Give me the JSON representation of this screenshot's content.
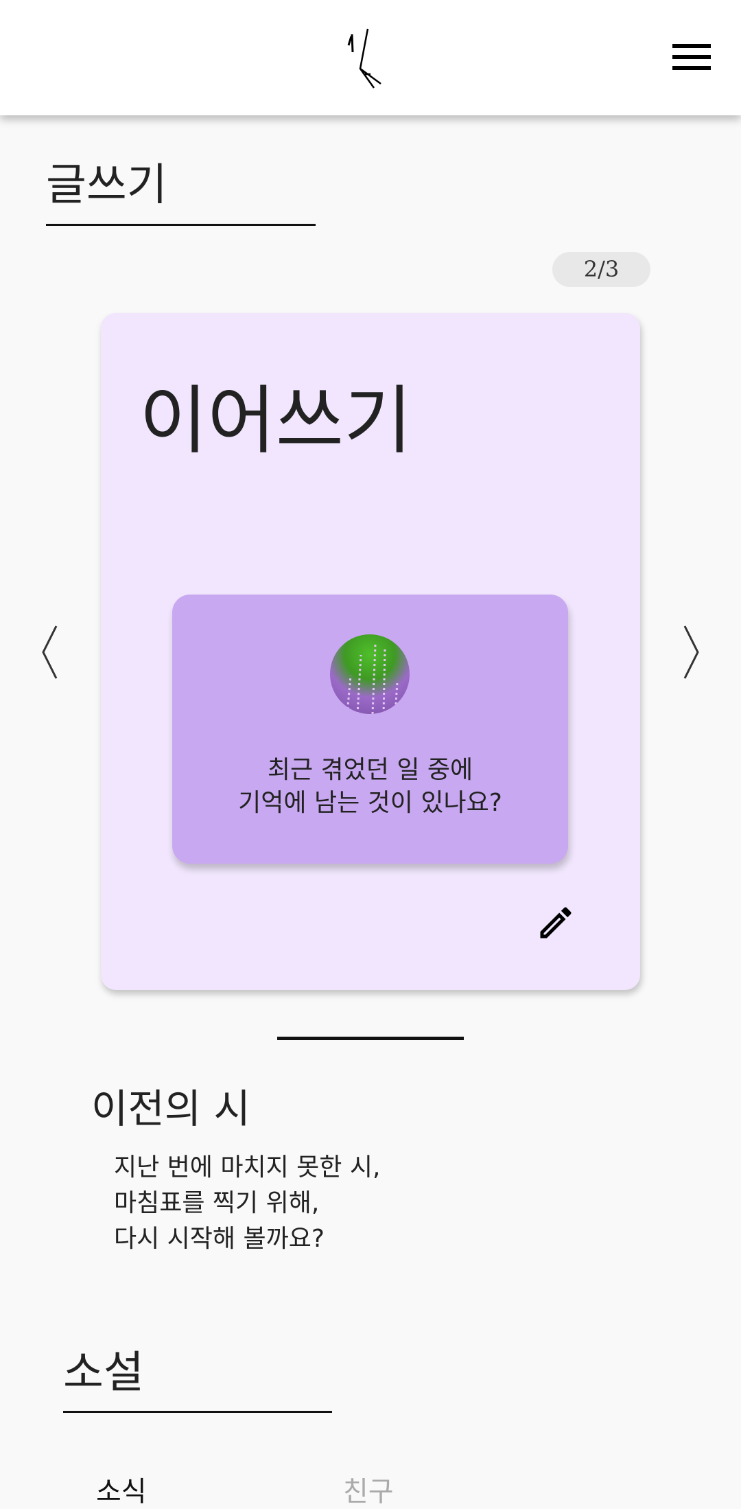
{
  "header": {
    "logo_text": "시",
    "menu_icon": "hamburger-menu-icon"
  },
  "writing": {
    "section_title": "글쓰기",
    "page_indicator": "2/3",
    "card": {
      "title": "이어쓰기",
      "bg_color": "#f1e6fd",
      "prompt_bg_color": "#c8a8f0",
      "prompt_line1": "최근 겪었던 일 중에",
      "prompt_line2": "기억에 남는 것이 있나요?",
      "image": "lavender-flower-photo",
      "edit_icon": "pencil-icon"
    },
    "prev_icon": "chevron-left-icon",
    "next_icon": "chevron-right-icon"
  },
  "previous_poem": {
    "title": "이전의 시",
    "lines": [
      "지난 번에 마치지 못한 시,",
      "마침표를 찍기 위해,",
      "다시 시작해 볼까요?"
    ]
  },
  "novel": {
    "section_title": "소설",
    "tabs": [
      {
        "label": "소식",
        "active": true
      },
      {
        "label": "친구",
        "active": false
      }
    ]
  }
}
